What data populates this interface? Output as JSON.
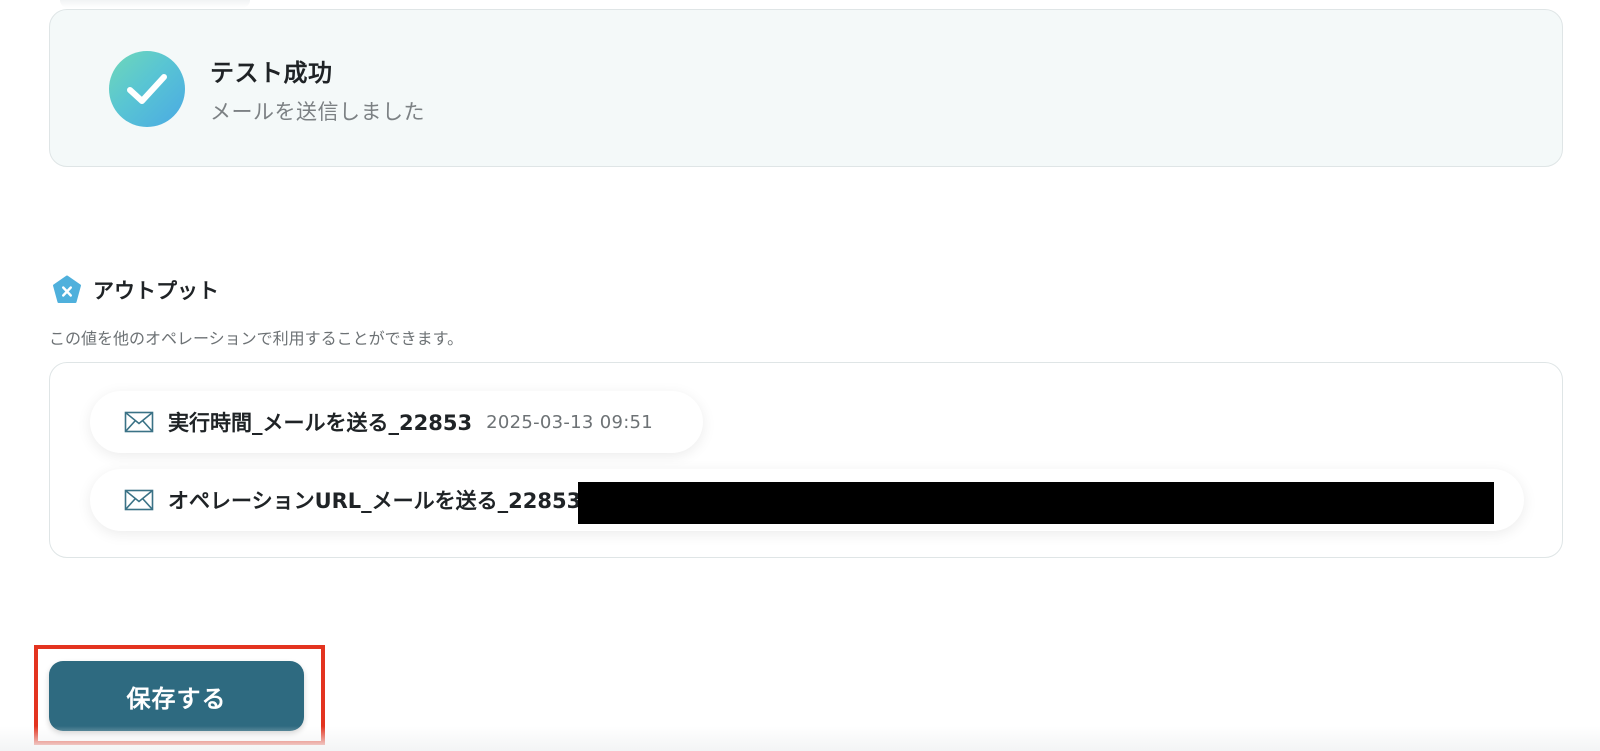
{
  "test_result": {
    "title": "テスト成功",
    "message": "メールを送信しました",
    "icon": "check-circle-icon"
  },
  "output": {
    "title": "アウトプット",
    "icon": "variable-pentagon-icon",
    "description": "この値を他のオペレーションで利用することができます。",
    "items": [
      {
        "label": "実行時間_メールを送る_22853",
        "value": "2025-03-13 09:51",
        "icon": "mail-icon"
      },
      {
        "label": "オペレーションURL_メールを送る_22853",
        "value": "",
        "icon": "mail-icon",
        "redacted": true
      }
    ]
  },
  "actions": {
    "save_label": "保存する"
  },
  "colors": {
    "accent": "#2e6a80",
    "success_gradient_start": "#6fd8b8",
    "success_gradient_end": "#4aa9e4",
    "highlight": "#e3331f",
    "card_background": "#f4f9f9"
  }
}
